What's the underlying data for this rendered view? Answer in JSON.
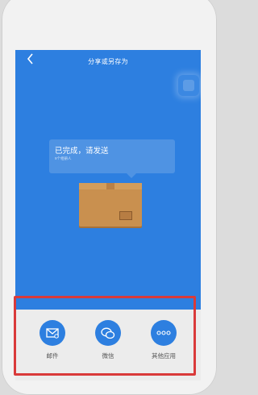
{
  "nav": {
    "back_icon": "chevron-left-icon",
    "title": "分享或另存为"
  },
  "bubble": {
    "title": "已完成，请发送",
    "subtitle": "9个相册人"
  },
  "share_items": [
    {
      "label": "邮件",
      "icon": "mail-icon"
    },
    {
      "label": "微信",
      "icon": "wechat-icon"
    },
    {
      "label": "其他应用",
      "icon": "more-dots-icon"
    }
  ],
  "colors": {
    "screen": "#2d7fe0",
    "panel": "#ececec",
    "highlight": "#d93a3a"
  }
}
